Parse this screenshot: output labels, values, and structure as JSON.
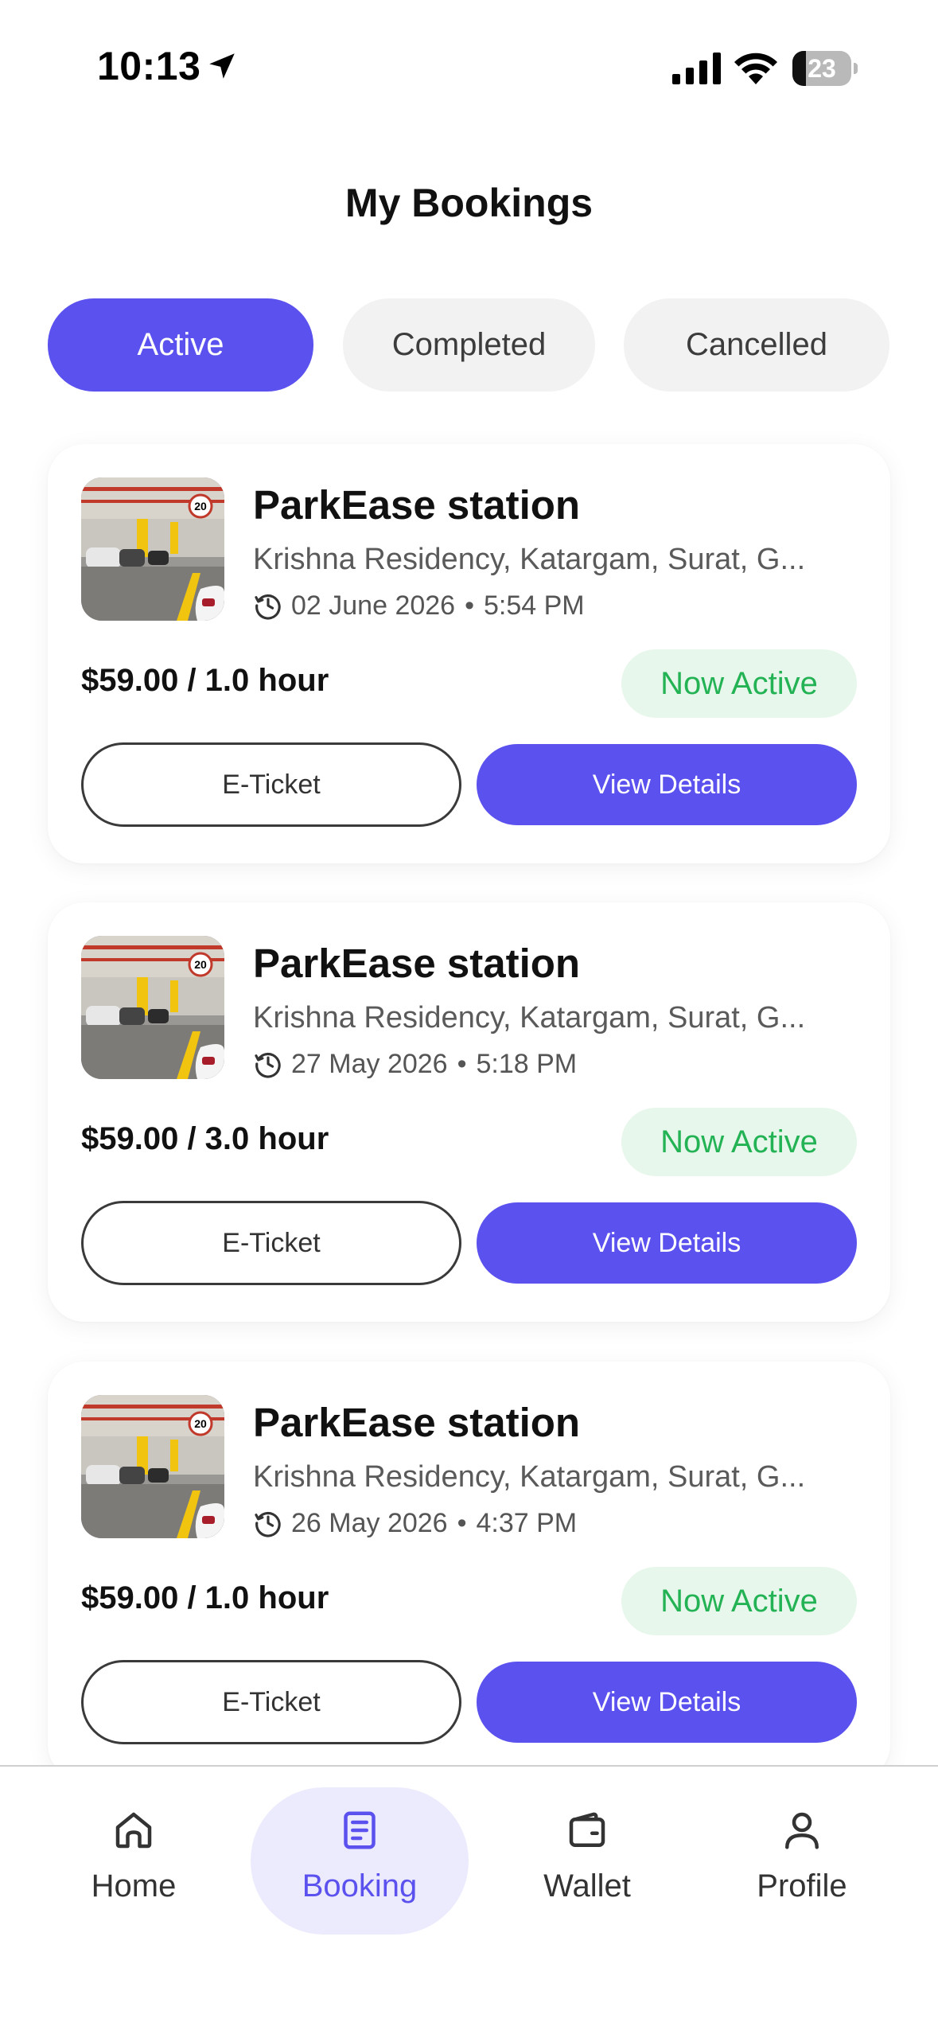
{
  "status_bar": {
    "time": "10:13",
    "battery": "23",
    "battery_level": 0.23
  },
  "header": {
    "title": "My Bookings"
  },
  "tabs": [
    {
      "label": "Active",
      "active": true
    },
    {
      "label": "Completed",
      "active": false
    },
    {
      "label": "Cancelled",
      "active": false
    }
  ],
  "bookings": [
    {
      "title": "ParkEase station",
      "address": "Krishna Residency, Katargam, Surat, G...",
      "date": "02 June 2026",
      "time": "5:54 PM",
      "price": "$59.00 / 1.0 hour",
      "status": "Now Active",
      "eticket_label": "E-Ticket",
      "details_label": "View Details"
    },
    {
      "title": "ParkEase station",
      "address": "Krishna Residency, Katargam, Surat, G...",
      "date": "27 May 2026",
      "time": "5:18 PM",
      "price": "$59.00 / 3.0 hour",
      "status": "Now Active",
      "eticket_label": "E-Ticket",
      "details_label": "View Details"
    },
    {
      "title": "ParkEase station",
      "address": "Krishna Residency, Katargam, Surat, G...",
      "date": "26 May 2026",
      "time": "4:37 PM",
      "price": "$59.00 / 1.0 hour",
      "status": "Now Active",
      "eticket_label": "E-Ticket",
      "details_label": "View Details"
    }
  ],
  "bottom_nav": [
    {
      "label": "Home",
      "icon": "home-icon",
      "active": false
    },
    {
      "label": "Booking",
      "icon": "booking-icon",
      "active": true
    },
    {
      "label": "Wallet",
      "icon": "wallet-icon",
      "active": false
    },
    {
      "label": "Profile",
      "icon": "profile-icon",
      "active": false
    }
  ],
  "colors": {
    "accent": "#5b51ee",
    "accent_soft": "#ecebfd",
    "success_text": "#23b254",
    "success_bg": "#e8f7ec",
    "inactive_tab_bg": "#f2f2f2"
  }
}
